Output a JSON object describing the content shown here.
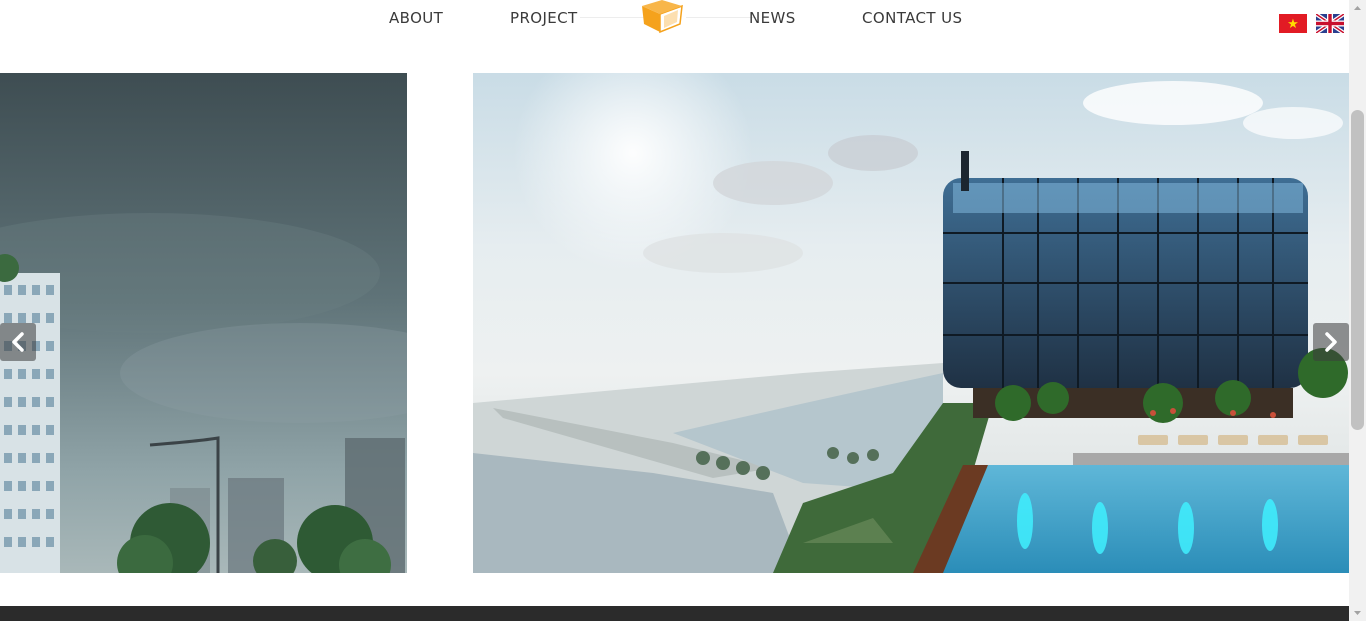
{
  "nav": {
    "about": "ABOUT",
    "project": "PROJECT",
    "news": "NEWS",
    "contact": "CONTACT US",
    "logo_icon": "box-logo-icon",
    "brand_color": "#f5a21c"
  },
  "languages": [
    {
      "code": "vi",
      "icon": "vietnam-flag-icon"
    },
    {
      "code": "en",
      "icon": "uk-flag-icon"
    }
  ],
  "slider": {
    "prev_icon": "chevron-left-icon",
    "next_icon": "chevron-right-icon",
    "slides": [
      {
        "image": "high-rise tower with city skyline and trees"
      },
      {
        "image": "rooftop glass restaurant with infinity pool by the river"
      }
    ]
  },
  "colors": {
    "footer": "#2b2b2b",
    "nav_text": "#3a3a3a"
  }
}
